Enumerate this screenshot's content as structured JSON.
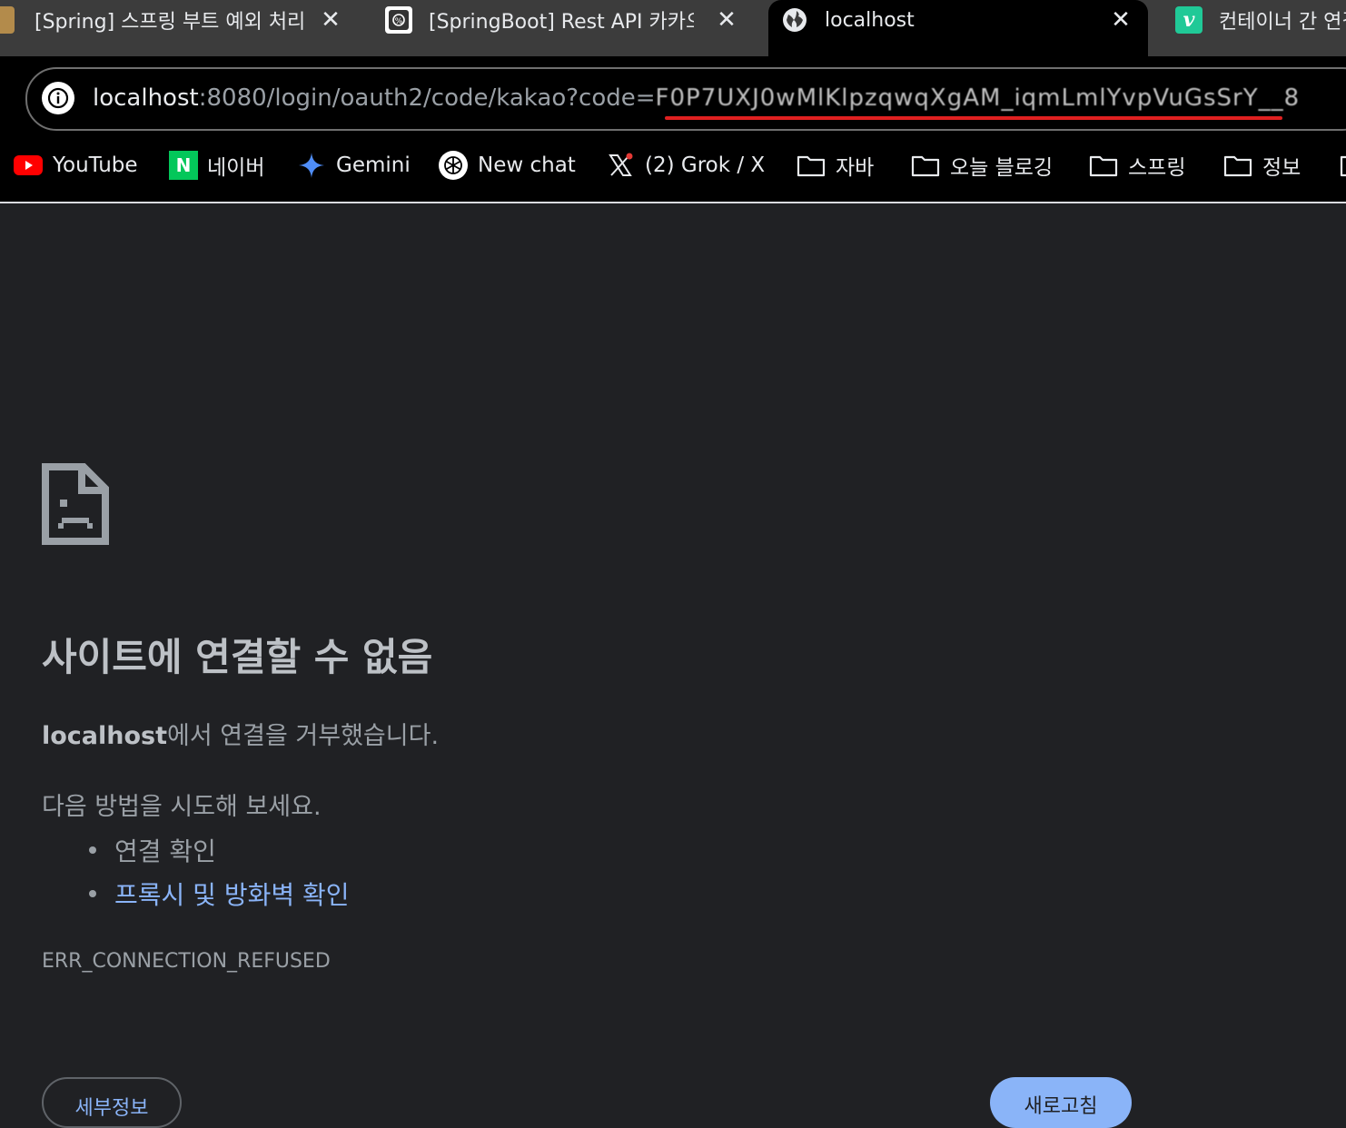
{
  "tabs": [
    {
      "title": "[Spring] 스프링 부트 예외 처리",
      "favicon": "blog-avatar-icon",
      "close": "✕",
      "active": false
    },
    {
      "title": "[SpringBoot] Rest API 카카오",
      "favicon": "tistory-icon",
      "close": "✕",
      "active": false
    },
    {
      "title": "localhost",
      "favicon": "globe-icon",
      "close": "✕",
      "active": true
    },
    {
      "title": "컨테이너 간 연결",
      "favicon": "velog-icon",
      "favicon_text": "v",
      "active": false
    }
  ],
  "omnibox": {
    "host": "localhost",
    "path": ":8080/login/oauth2/code/kakao?code=",
    "redacted_code": "F0P7UXJ0wMlKlpzqwqXgAM_iqmLmlYvpVuGsSrY__8"
  },
  "bookmarks": [
    {
      "label": "YouTube",
      "icon": "youtube-icon"
    },
    {
      "label": "네이버",
      "icon": "naver-icon",
      "icon_text": "N"
    },
    {
      "label": "Gemini",
      "icon": "gemini-icon"
    },
    {
      "label": "New chat",
      "icon": "chatgpt-icon"
    },
    {
      "label": "(2) Grok / X",
      "icon": "x-icon"
    },
    {
      "label": "자바",
      "icon": "folder-icon"
    },
    {
      "label": "오늘 블로깅",
      "icon": "folder-icon"
    },
    {
      "label": "스프링",
      "icon": "folder-icon"
    },
    {
      "label": "정보",
      "icon": "folder-icon"
    }
  ],
  "error": {
    "title": "사이트에 연결할 수 없음",
    "message_host": "localhost",
    "message_rest": "에서 연결을 거부했습니다.",
    "suggest": "다음 방법을 시도해 보세요.",
    "items": [
      "연결 확인",
      "프록시 및 방화벽 확인"
    ],
    "code": "ERR_CONNECTION_REFUSED",
    "details_button": "세부정보",
    "reload_button": "새로고침"
  },
  "colors": {
    "page_bg": "#202124",
    "link": "#8ab4f8",
    "text": "#9aa0a6",
    "redline": "#e02020"
  }
}
